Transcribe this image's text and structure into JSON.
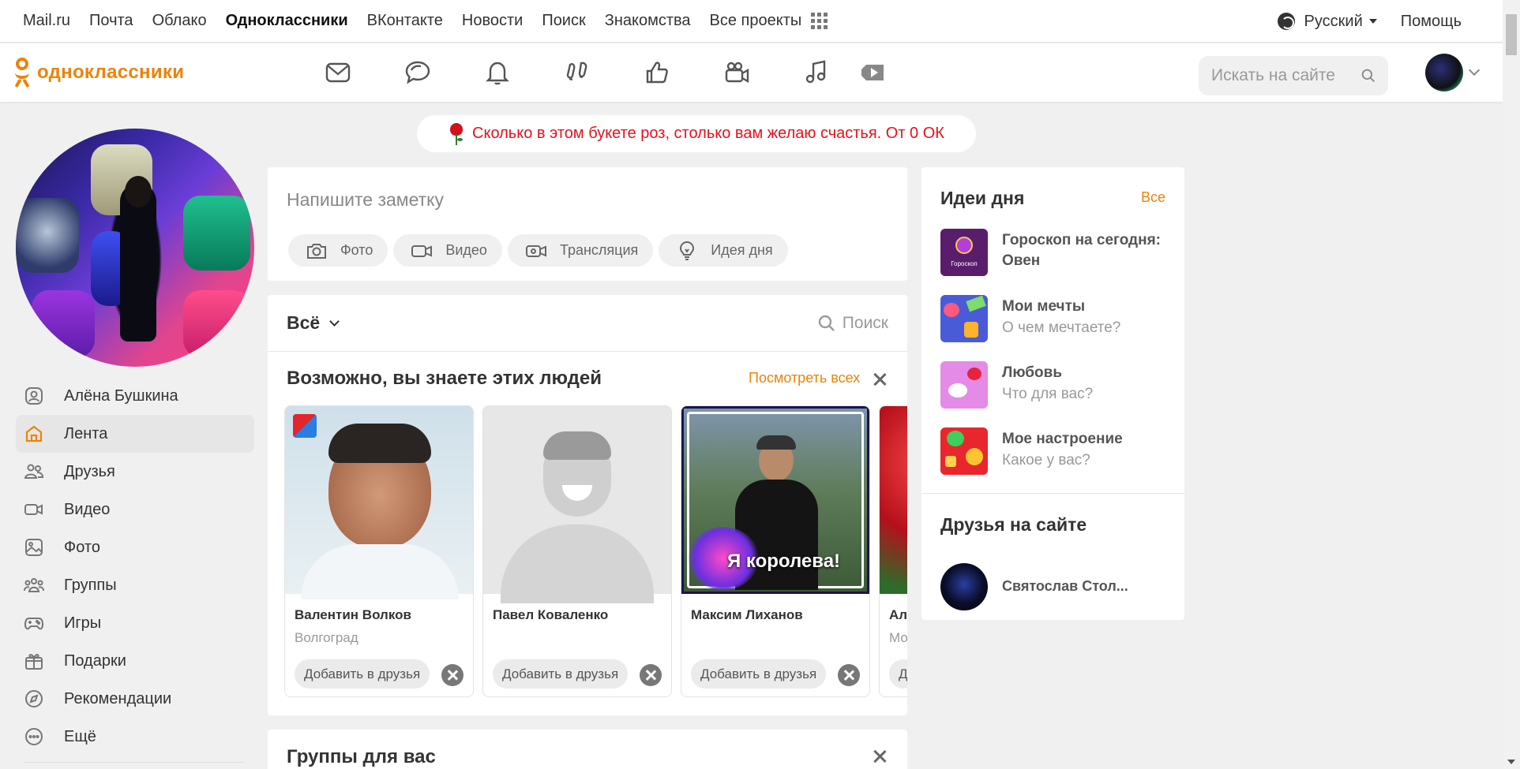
{
  "portal": {
    "links": [
      "Mail.ru",
      "Почта",
      "Облако",
      "Одноклассники",
      "ВКонтакте",
      "Новости",
      "Поиск",
      "Знакомства",
      "Все проекты"
    ],
    "active_link": "Одноклассники",
    "language": "Русский",
    "help": "Помощь"
  },
  "header": {
    "logo_text": "одноклассники",
    "nav_icons": [
      "mail-icon",
      "chat-icon",
      "bell-icon",
      "guests-icon",
      "likes-icon",
      "video-camera-icon",
      "music-icon",
      "video-play-icon"
    ],
    "search_placeholder": "Искать на сайте"
  },
  "banner": {
    "text": "Сколько в этом букете роз, столько вам желаю счастья. От 0 ОК"
  },
  "left_menu": {
    "items": [
      {
        "label": "Алёна Бушкина",
        "icon": "profile-icon",
        "active": false
      },
      {
        "label": "Лента",
        "icon": "home-icon",
        "active": true
      },
      {
        "label": "Друзья",
        "icon": "friends-icon",
        "active": false
      },
      {
        "label": "Видео",
        "icon": "video-icon",
        "active": false
      },
      {
        "label": "Фото",
        "icon": "photo-icon",
        "active": false
      },
      {
        "label": "Группы",
        "icon": "groups-icon",
        "active": false
      },
      {
        "label": "Игры",
        "icon": "gamepad-icon",
        "active": false
      },
      {
        "label": "Подарки",
        "icon": "gift-icon",
        "active": false
      },
      {
        "label": "Рекомендации",
        "icon": "compass-icon",
        "active": false
      },
      {
        "label": "Ещё",
        "icon": "more-icon",
        "active": false
      }
    ]
  },
  "composer": {
    "placeholder": "Напишите заметку",
    "chips": [
      {
        "label": "Фото",
        "icon": "camera-icon"
      },
      {
        "label": "Видео",
        "icon": "video-icon"
      },
      {
        "label": "Трансляция",
        "icon": "broadcast-icon"
      },
      {
        "label": "Идея дня",
        "icon": "lightbulb-icon"
      }
    ]
  },
  "feed": {
    "filter_label": "Всё",
    "search_label": "Поиск",
    "pymk": {
      "title": "Возможно, вы знаете этих людей",
      "see_all": "Посмотреть всех",
      "people": [
        {
          "name": "Валентин Волков",
          "city": "Волгоград",
          "add": "Добавить в друзья"
        },
        {
          "name": "Павел Коваленко",
          "city": "",
          "add": "Добавить в друзья"
        },
        {
          "name": "Максим Лиханов",
          "city": "",
          "add": "Добавить в друзья",
          "overlay_text": "Я королева!"
        },
        {
          "name": "Ал",
          "city": "Мо",
          "add": "Д"
        }
      ]
    },
    "groups_title": "Группы для вас"
  },
  "ideas": {
    "title": "Идеи дня",
    "all": "Все",
    "items": [
      {
        "title": "Гороскоп на сегодня: Овен",
        "subtitle": "",
        "image_label": "Гороскоп"
      },
      {
        "title": "Мои мечты",
        "subtitle": "О чем мечтаете?"
      },
      {
        "title": "Любовь",
        "subtitle": "Что для вас?"
      },
      {
        "title": "Мое настроение",
        "subtitle": "Какое у вас?"
      }
    ]
  },
  "friends_online": {
    "title": "Друзья на сайте",
    "friends": [
      {
        "name": "Святослав Стол..."
      }
    ]
  },
  "colors": {
    "brand_orange": "#ee8208",
    "banner_red": "#e8101c",
    "background": "#f0f0f0"
  }
}
